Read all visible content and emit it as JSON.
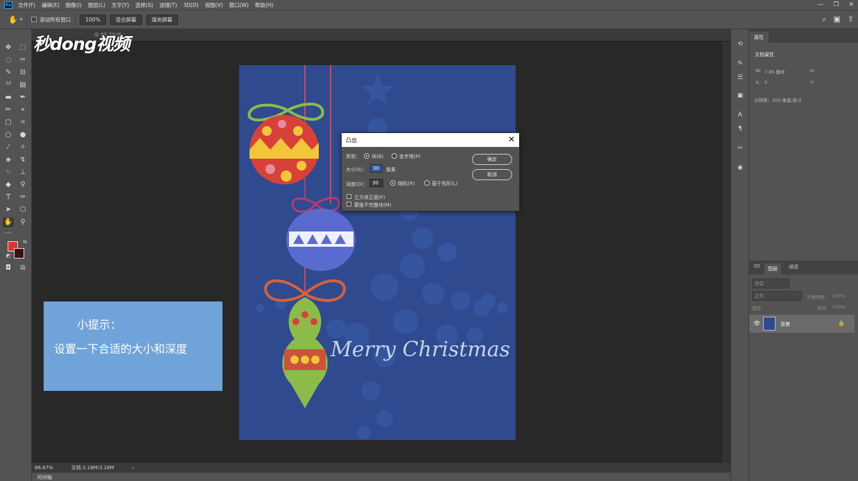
{
  "menu": {
    "items": [
      "文件(F)",
      "编辑(E)",
      "图像(I)",
      "图层(L)",
      "文字(Y)",
      "选择(S)",
      "滤镜(T)",
      "3D(D)",
      "视图(V)",
      "窗口(W)",
      "帮助(H)"
    ]
  },
  "options": {
    "scroll_all_label": "滚动所有窗口",
    "zoom_value": "100%",
    "fit_screen_label": "适合屏幕",
    "fill_screen_label": "填充屏幕"
  },
  "document": {
    "tab_title": "@ 66.7%(R...",
    "zoom": "66.67%",
    "doc_size": "文档:3.18M/3.18M"
  },
  "watermark": "秒dong视频",
  "artwork": {
    "greeting": "Merry Christmas"
  },
  "tip": {
    "title": "小提示：",
    "body": "设置一下合适的大小和深度"
  },
  "dialog": {
    "title": "凸出",
    "type_label": "类型：",
    "type_block": "块(B)",
    "type_pyramid": "金字塔(P)",
    "size_label": "大小(S)：",
    "size_value": "30",
    "size_unit": "像素",
    "depth_label": "深度(D)：",
    "depth_value": "30",
    "depth_random": "随机(R)",
    "depth_level": "基于色阶(L)",
    "cube_face": "立方体正面(F)",
    "mask_incomplete": "蒙版不完整块(M)",
    "ok_button": "确定",
    "cancel_button": "取消"
  },
  "properties": {
    "tab": "属性",
    "sub_title": "文档属性",
    "w_label": "W:",
    "w_value": "7.85 厘米",
    "h_label": "H:",
    "x_label": "X:",
    "x_value": "0",
    "y_label": "Y:",
    "resolution": "分辨率：300 像素/英寸"
  },
  "layers": {
    "tab_3d": "3D",
    "tab_layers": "图层",
    "tab_channels": "通道",
    "search_placeholder": "类型",
    "blend_mode": "正常",
    "opacity_label": "不透明度：",
    "opacity_value": "100%",
    "lock_label": "锁定：",
    "fill_label": "填充：",
    "fill_value": "100%",
    "background_layer": "背景"
  },
  "timeline": {
    "label": "时间轴"
  }
}
